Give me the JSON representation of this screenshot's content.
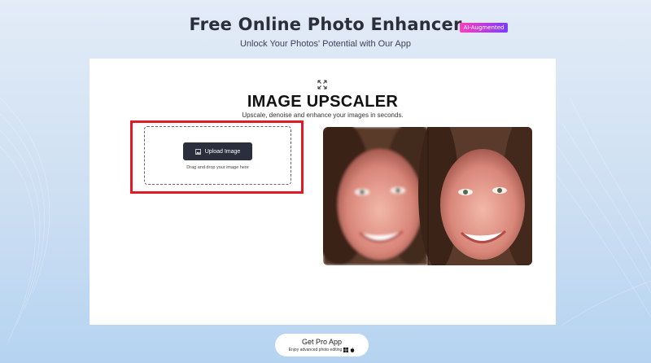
{
  "header": {
    "title": "Free Online Photo Enhancer",
    "badge": "AI-Augmented",
    "subtitle": "Unlock Your Photos' Potential with Our App"
  },
  "tool": {
    "title": "IMAGE UPSCALER",
    "description": "Upscale, denoise and enhance your images in seconds."
  },
  "upload": {
    "button_label": "Upload Image",
    "drop_hint": "Drag and drop your image here"
  },
  "footer": {
    "pro_label": "Get Pro App",
    "pro_sub": "Enjoy advanced photo editing"
  },
  "icons": [
    "fullscreen-icon",
    "image-icon",
    "windows-icon",
    "apple-icon"
  ],
  "colors": {
    "highlight": "#e01b24",
    "button": "#2b2e3d",
    "badge_start": "#ff3dbb",
    "badge_end": "#7b3cff"
  }
}
